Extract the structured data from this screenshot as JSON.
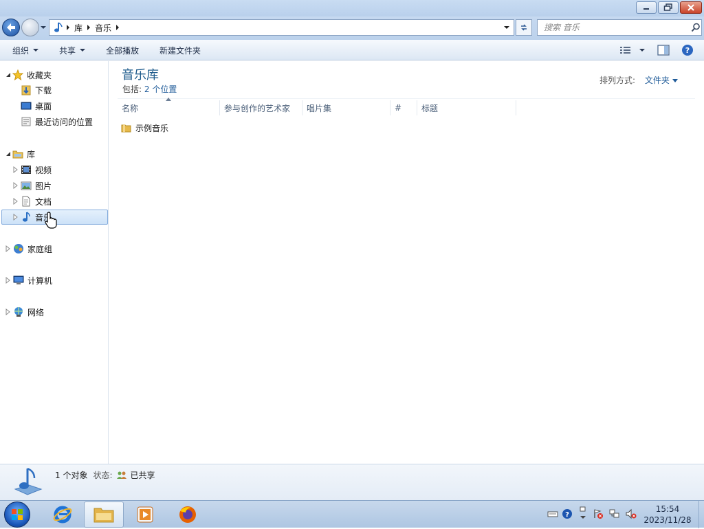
{
  "window": {
    "min_label": "▭",
    "max_label": "❐",
    "close_label": "✕"
  },
  "address": {
    "crumbs": [
      "库",
      "音乐"
    ]
  },
  "search": {
    "placeholder": "搜索 音乐"
  },
  "toolbar": {
    "organize": "组织",
    "share": "共享",
    "play_all": "全部播放",
    "new_folder": "新建文件夹"
  },
  "nav": {
    "favorites": {
      "label": "收藏夹",
      "items": [
        "下载",
        "桌面",
        "最近访问的位置"
      ]
    },
    "libraries": {
      "label": "库",
      "items": [
        "视频",
        "图片",
        "文档",
        "音乐"
      ],
      "selected": "音乐"
    },
    "homegroup": "家庭组",
    "computer": "计算机",
    "network": "网络"
  },
  "content": {
    "title": "音乐库",
    "includes_label": "包括:",
    "includes_link": "2 个位置",
    "arrange_label": "排列方式:",
    "arrange_value": "文件夹",
    "columns": [
      "名称",
      "参与创作的艺术家",
      "唱片集",
      "#",
      "标题"
    ],
    "items": [
      {
        "name": "示例音乐",
        "type": "folder"
      }
    ]
  },
  "details": {
    "count": "1 个对象",
    "status_label": "状态:",
    "status_value": "已共享"
  },
  "taskbar": {
    "time": "15:54",
    "date": "2023/11/28",
    "icons": [
      "start-orb",
      "internet-explorer-icon",
      "file-explorer-icon",
      "media-player-icon",
      "firefox-icon"
    ]
  },
  "colors": {
    "accent": "#1e5b8c",
    "link": "#1f5b99",
    "selection": "#cde2f8"
  }
}
